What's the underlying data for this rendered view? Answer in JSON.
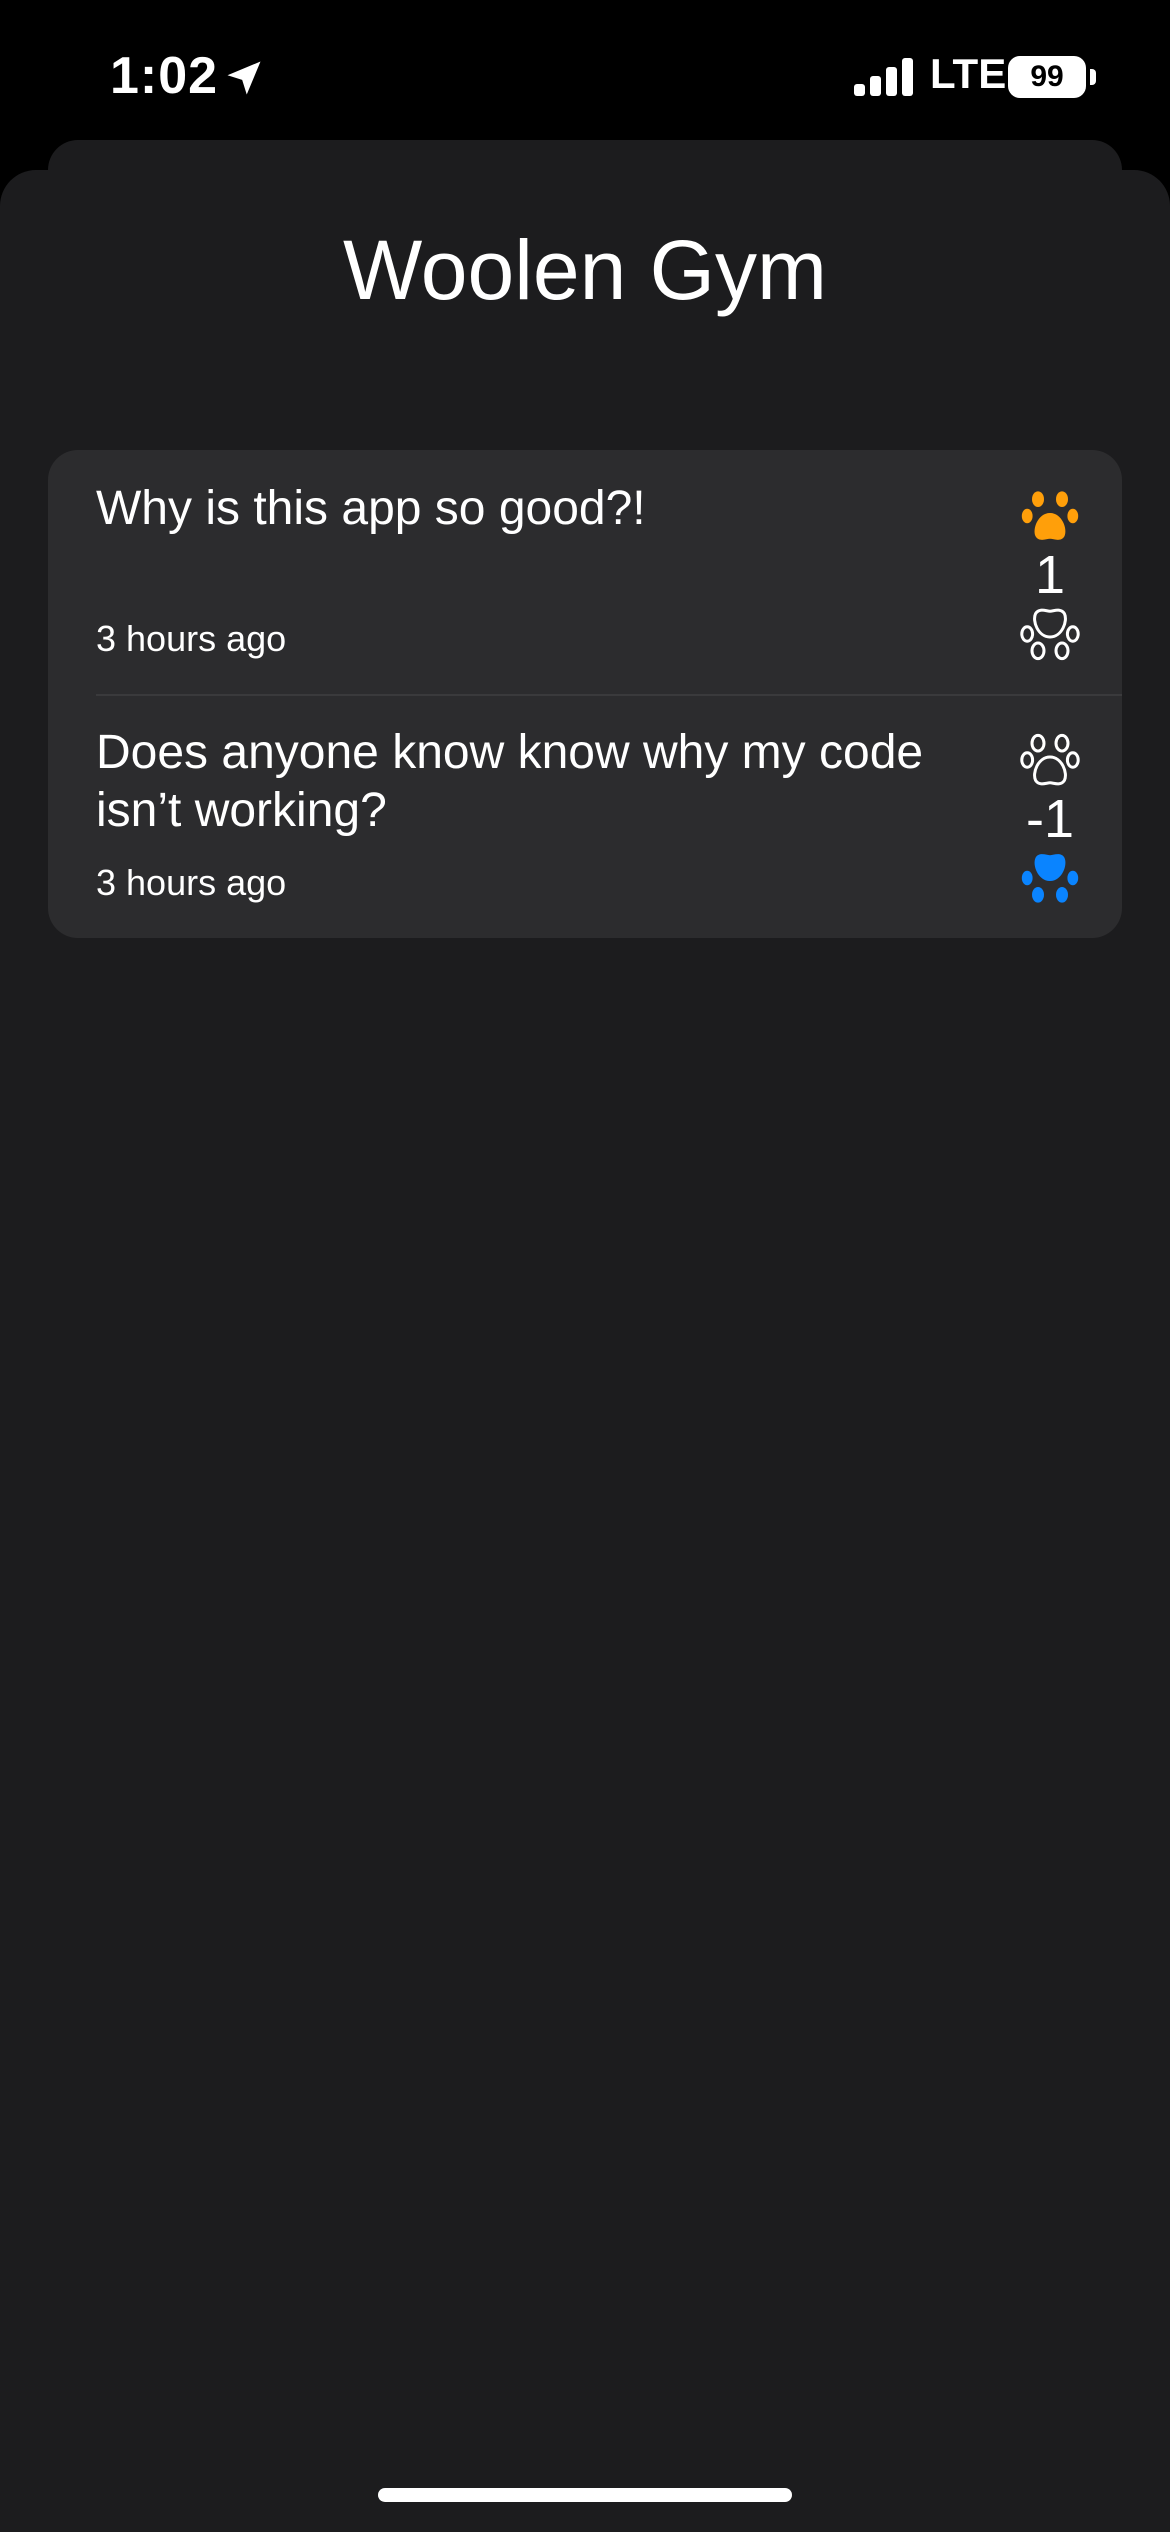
{
  "status_bar": {
    "time": "1:02",
    "carrier": "LTE",
    "battery": "99",
    "icons": [
      "location-arrow-icon",
      "signal-bars-icon",
      "battery-icon"
    ]
  },
  "header": {
    "title": "Woolen Gym"
  },
  "posts": [
    {
      "text": "Why is this app so good?!",
      "time": "3 hours ago",
      "votes": "1",
      "upvote_icon": "paw-filled-icon",
      "upvote_color": "#ff9f0a",
      "downvote_icon": "paw-outline-icon",
      "downvote_color": "#ffffff"
    },
    {
      "text": "Does anyone know know why my code isn’t working?",
      "time": "3 hours ago",
      "votes": "-1",
      "upvote_icon": "paw-outline-icon",
      "upvote_color": "#ffffff",
      "downvote_icon": "paw-filled-icon",
      "downvote_color": "#0a84ff"
    }
  ],
  "colors": {
    "background": "#1c1c1e",
    "card": "#2c2c2e",
    "upvote_active": "#ff9f0a",
    "downvote_active": "#0a84ff"
  }
}
